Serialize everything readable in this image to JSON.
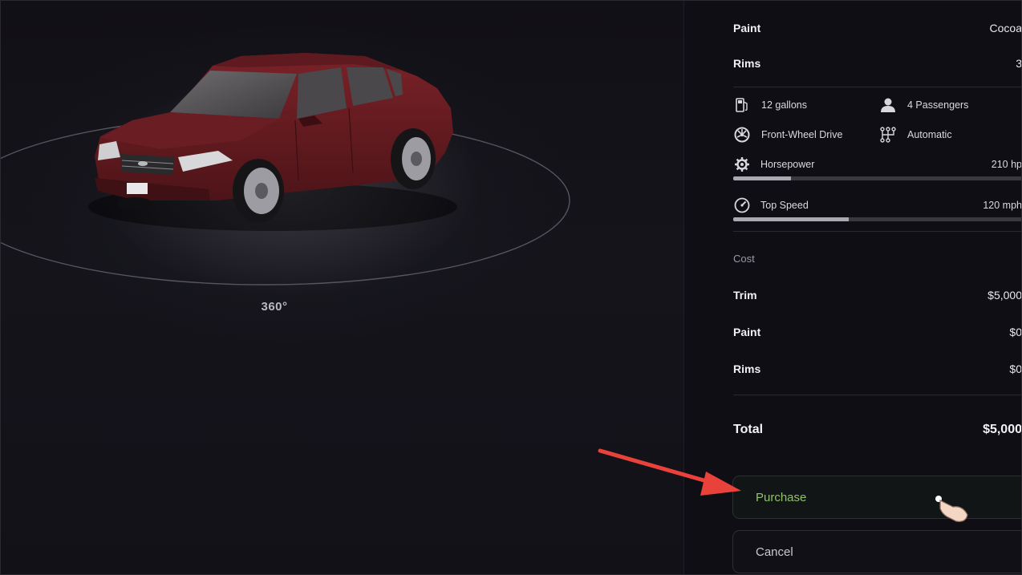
{
  "viewer": {
    "rotate_label": "360°"
  },
  "details": {
    "paint": {
      "label": "Paint",
      "value": "Cocoa"
    },
    "rims": {
      "label": "Rims",
      "value": "3"
    }
  },
  "specs": {
    "fuel": {
      "icon": "fuel-pump-icon",
      "text": "12 gallons"
    },
    "passengers": {
      "icon": "person-icon",
      "text": "4 Passengers"
    },
    "drivetrain": {
      "icon": "wheel-icon",
      "text": "Front-Wheel Drive"
    },
    "transmission": {
      "icon": "gear-shift-icon",
      "text": "Automatic"
    },
    "horsepower": {
      "icon": "engine-gear-icon",
      "label": "Horsepower",
      "value": "210 hp",
      "fill_fraction": 0.2
    },
    "top_speed": {
      "icon": "speedometer-icon",
      "label": "Top Speed",
      "value": "120 mph",
      "fill_fraction": 0.4
    }
  },
  "cost": {
    "title": "Cost",
    "trim": {
      "label": "Trim",
      "value": "$5,000"
    },
    "paint": {
      "label": "Paint",
      "value": "$0"
    },
    "rims": {
      "label": "Rims",
      "value": "$0"
    },
    "total": {
      "label": "Total",
      "value": "$5,000"
    }
  },
  "actions": {
    "purchase_label": "Purchase",
    "cancel_label": "Cancel"
  },
  "colors": {
    "accent_green": "#8fc26a",
    "annotation_arrow": "#e8423a",
    "car_body": "#6b1e22"
  }
}
